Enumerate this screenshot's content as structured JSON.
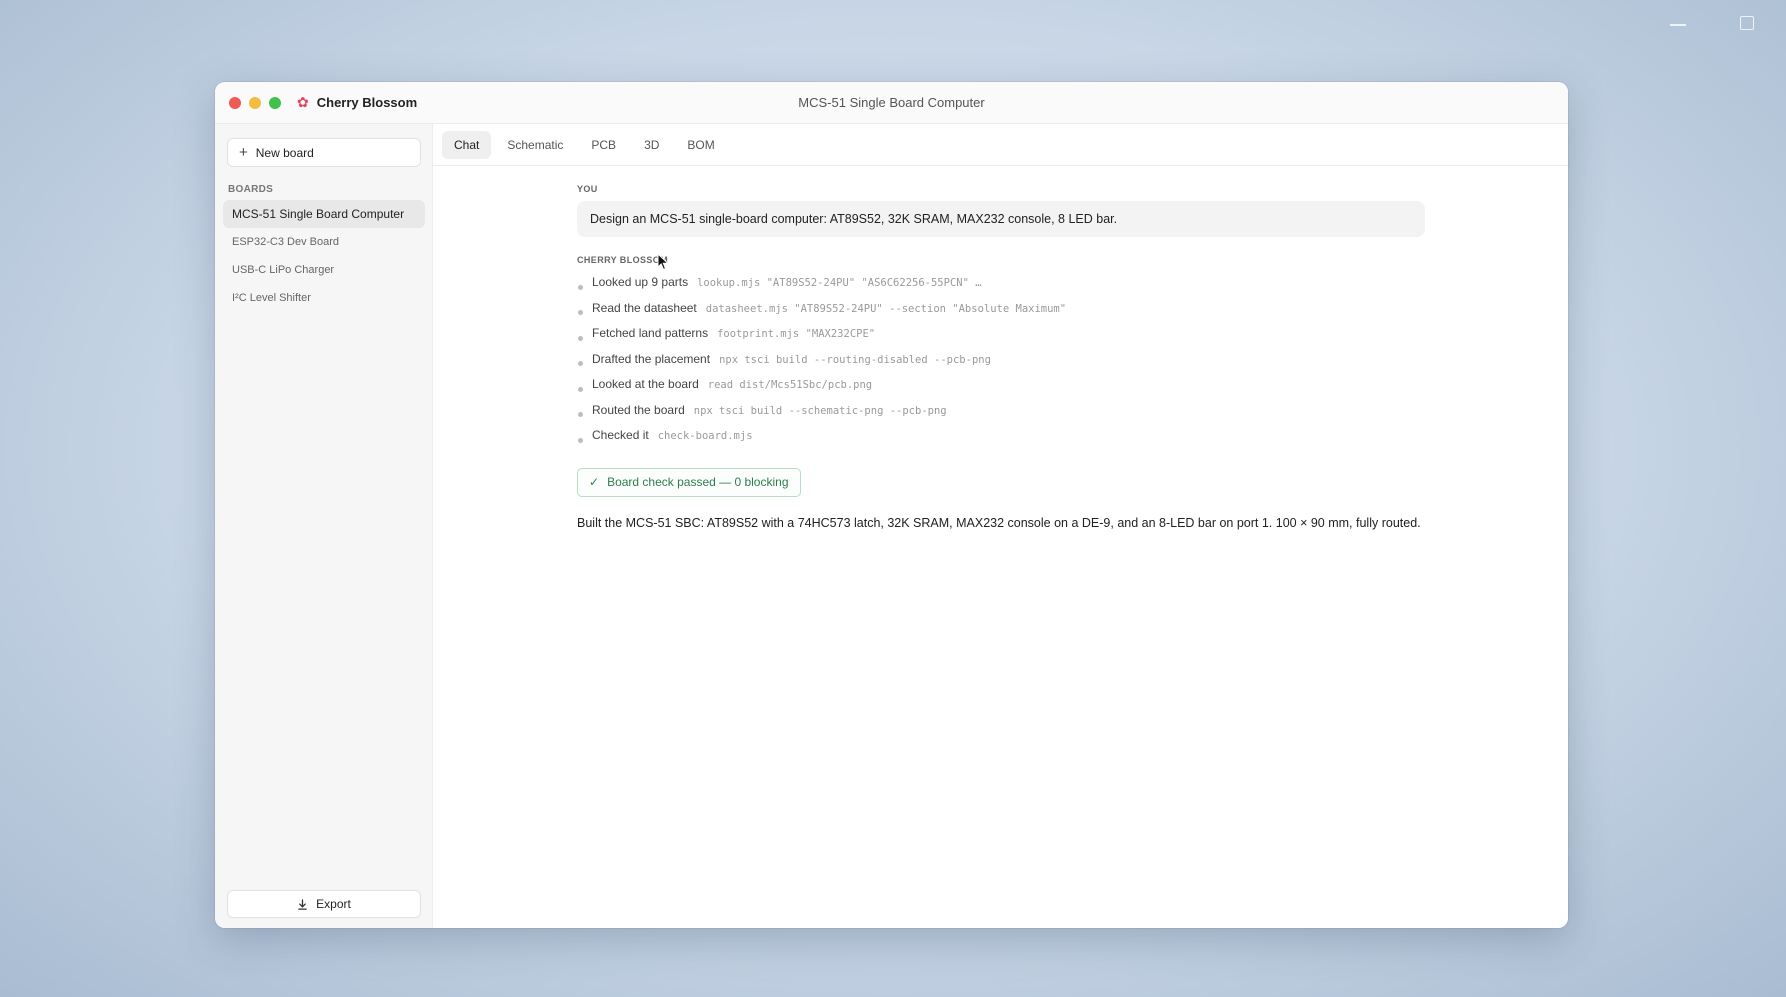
{
  "app": {
    "name": "Cherry Blossom",
    "window_title": "MCS-51 Single Board Computer",
    "logo_icon": "cherry-blossom-icon",
    "accent": "#e0445f"
  },
  "sidebar": {
    "new_board_label": "New board",
    "boards_heading": "BOARDS",
    "boards": [
      {
        "label": "MCS-51 Single Board Computer",
        "active": true
      },
      {
        "label": "ESP32-C3 Dev Board",
        "active": false
      },
      {
        "label": "USB-C LiPo Charger",
        "active": false
      },
      {
        "label": "I²C Level Shifter",
        "active": false
      }
    ],
    "export_label": "Export"
  },
  "tabs": [
    {
      "label": "Chat",
      "active": true
    },
    {
      "label": "Schematic",
      "active": false
    },
    {
      "label": "PCB",
      "active": false
    },
    {
      "label": "3D",
      "active": false
    },
    {
      "label": "BOM",
      "active": false
    }
  ],
  "chat": {
    "user_label": "YOU",
    "user_message": "Design an MCS-51 single-board computer: AT89S52, 32K SRAM, MAX232 console, 8 LED bar.",
    "bot_label": "CHERRY BLOSSOM",
    "steps": [
      {
        "text": "Looked up 9 parts",
        "cmd": "lookup.mjs \"AT89S52-24PU\" \"AS6C62256-55PCN\" …"
      },
      {
        "text": "Read the datasheet",
        "cmd": "datasheet.mjs \"AT89S52-24PU\" --section \"Absolute Maximum\""
      },
      {
        "text": "Fetched land patterns",
        "cmd": "footprint.mjs \"MAX232CPE\""
      },
      {
        "text": "Drafted the placement",
        "cmd": "npx tsci build --routing-disabled --pcb-png"
      },
      {
        "text": "Looked at the board",
        "cmd": "read dist/Mcs51Sbc/pcb.png"
      },
      {
        "text": "Routed the board",
        "cmd": "npx tsci build --schematic-png --pcb-png"
      },
      {
        "text": "Checked it",
        "cmd": "check-board.mjs"
      }
    ],
    "check_badge": "Board check passed — 0 blocking",
    "summary": "Built the MCS-51 SBC: AT89S52 with a 74HC573 latch, 32K SRAM, MAX232 console on a DE-9, and an 8-LED bar on port 1. 100 × 90 mm, fully routed."
  }
}
